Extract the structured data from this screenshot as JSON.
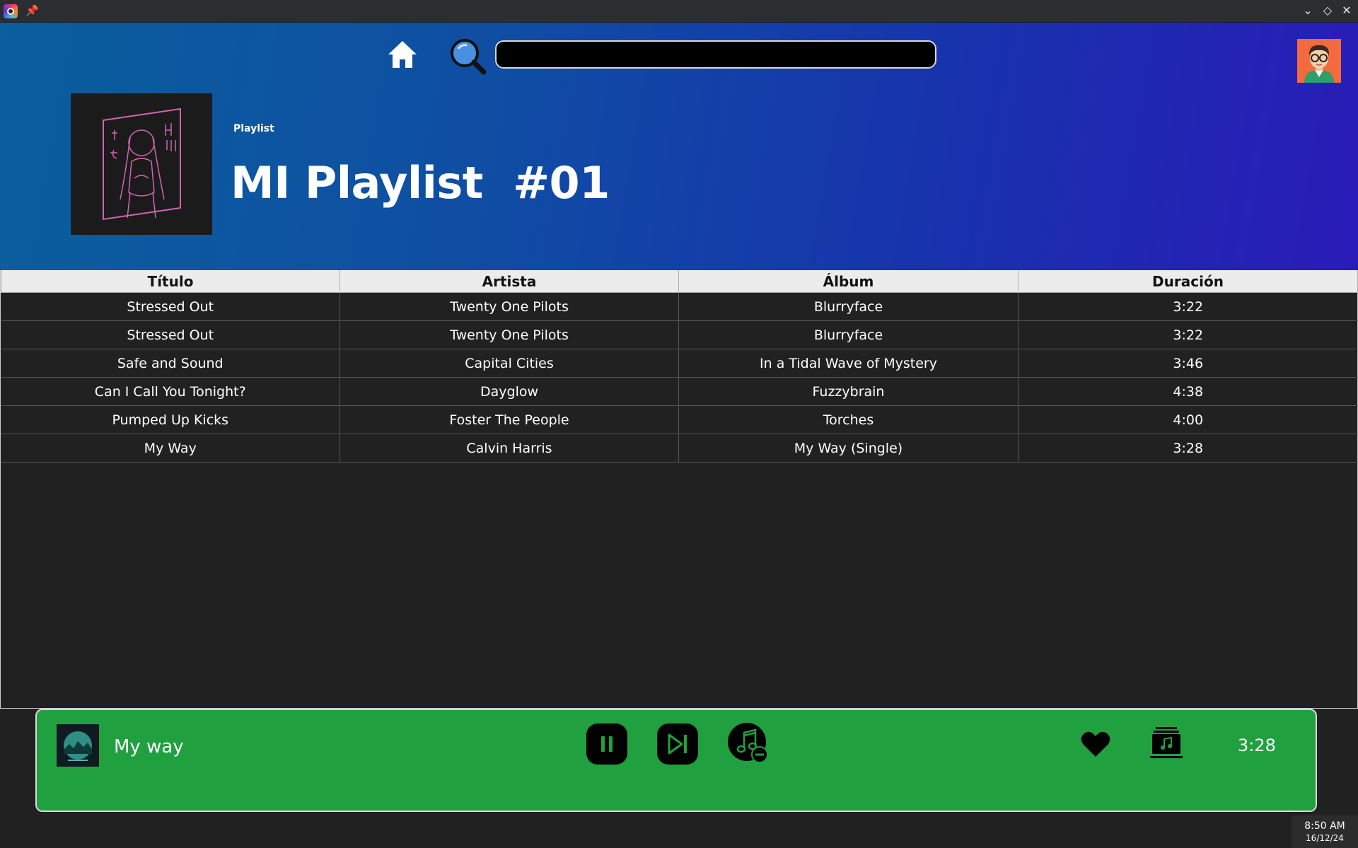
{
  "window": {
    "controls": [
      "minimize-icon",
      "maximize-icon",
      "close-icon"
    ]
  },
  "header": {
    "search": {
      "value": "",
      "placeholder": ""
    },
    "playlist_type": "Playlist",
    "playlist_title": "MI Playlist  #01",
    "gradient_colors": [
      "#0a5f9e",
      "#2a1bb8"
    ]
  },
  "table": {
    "columns": [
      "Título",
      "Artista",
      "Álbum",
      "Duración"
    ],
    "rows": [
      {
        "title": "Stressed Out",
        "artist": "Twenty One Pilots",
        "album": "Blurryface",
        "duration": "3:22"
      },
      {
        "title": "Stressed Out",
        "artist": "Twenty One Pilots",
        "album": "Blurryface",
        "duration": "3:22"
      },
      {
        "title": "Safe and Sound",
        "artist": "Capital Cities",
        "album": "In a Tidal Wave of Mystery",
        "duration": "3:46"
      },
      {
        "title": "Can I Call You Tonight?",
        "artist": "Dayglow",
        "album": "Fuzzybrain",
        "duration": "4:38"
      },
      {
        "title": "Pumped Up Kicks",
        "artist": "Foster The People",
        "album": "Torches",
        "duration": "4:00"
      },
      {
        "title": "My Way",
        "artist": "Calvin Harris",
        "album": "My Way (Single)",
        "duration": "3:28"
      }
    ]
  },
  "player": {
    "now_playing_title": "My way",
    "duration": "3:28",
    "accent_color": "#21a040",
    "controls": [
      "pause-icon",
      "skip-next-icon",
      "remove-from-queue-icon",
      "heart-icon",
      "music-library-icon"
    ]
  },
  "taskbar": {
    "time": "8:50 AM",
    "date": "16/12/24"
  }
}
